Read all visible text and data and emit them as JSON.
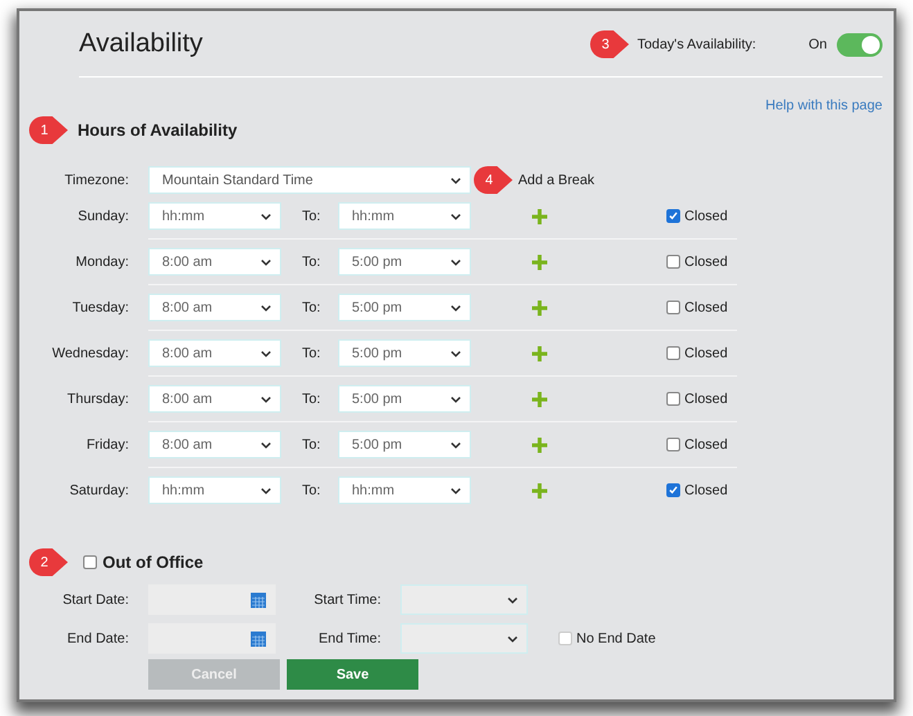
{
  "header": {
    "title": "Availability",
    "callout": "3",
    "today_label": "Today's Availability:",
    "toggle_text": "On",
    "toggle_on": true
  },
  "help_link": "Help with this page",
  "hours": {
    "callout": "1",
    "heading": "Hours of Availability",
    "timezone_label": "Timezone:",
    "timezone": "Mountain Standard Time",
    "break_callout": "4",
    "add_break": "Add a Break",
    "days": [
      {
        "day": "Sunday:",
        "from": "hh:mm",
        "to_label": "To:",
        "to": "hh:mm",
        "closed_label": "Closed",
        "closed": true
      },
      {
        "day": "Monday:",
        "from": "8:00 am",
        "to_label": "To:",
        "to": "5:00 pm",
        "closed_label": "Closed",
        "closed": false
      },
      {
        "day": "Tuesday:",
        "from": "8:00 am",
        "to_label": "To:",
        "to": "5:00 pm",
        "closed_label": "Closed",
        "closed": false
      },
      {
        "day": "Wednesday:",
        "from": "8:00 am",
        "to_label": "To:",
        "to": "5:00 pm",
        "closed_label": "Closed",
        "closed": false
      },
      {
        "day": "Thursday:",
        "from": "8:00 am",
        "to_label": "To:",
        "to": "5:00 pm",
        "closed_label": "Closed",
        "closed": false
      },
      {
        "day": "Friday:",
        "from": "8:00 am",
        "to_label": "To:",
        "to": "5:00 pm",
        "closed_label": "Closed",
        "closed": false
      },
      {
        "day": "Saturday:",
        "from": "hh:mm",
        "to_label": "To:",
        "to": "hh:mm",
        "closed_label": "Closed",
        "closed": true
      }
    ]
  },
  "out_of_office": {
    "callout": "2",
    "heading": "Out of Office",
    "checked": false,
    "start_date_label": "Start Date:",
    "start_time_label": "Start Time:",
    "end_date_label": "End Date:",
    "end_time_label": "End Time:",
    "no_end_date_label": "No End Date",
    "no_end_date": false
  },
  "buttons": [
    {
      "label": "Cancel",
      "kind": "cancel"
    },
    {
      "label": "Save",
      "kind": "save"
    }
  ]
}
